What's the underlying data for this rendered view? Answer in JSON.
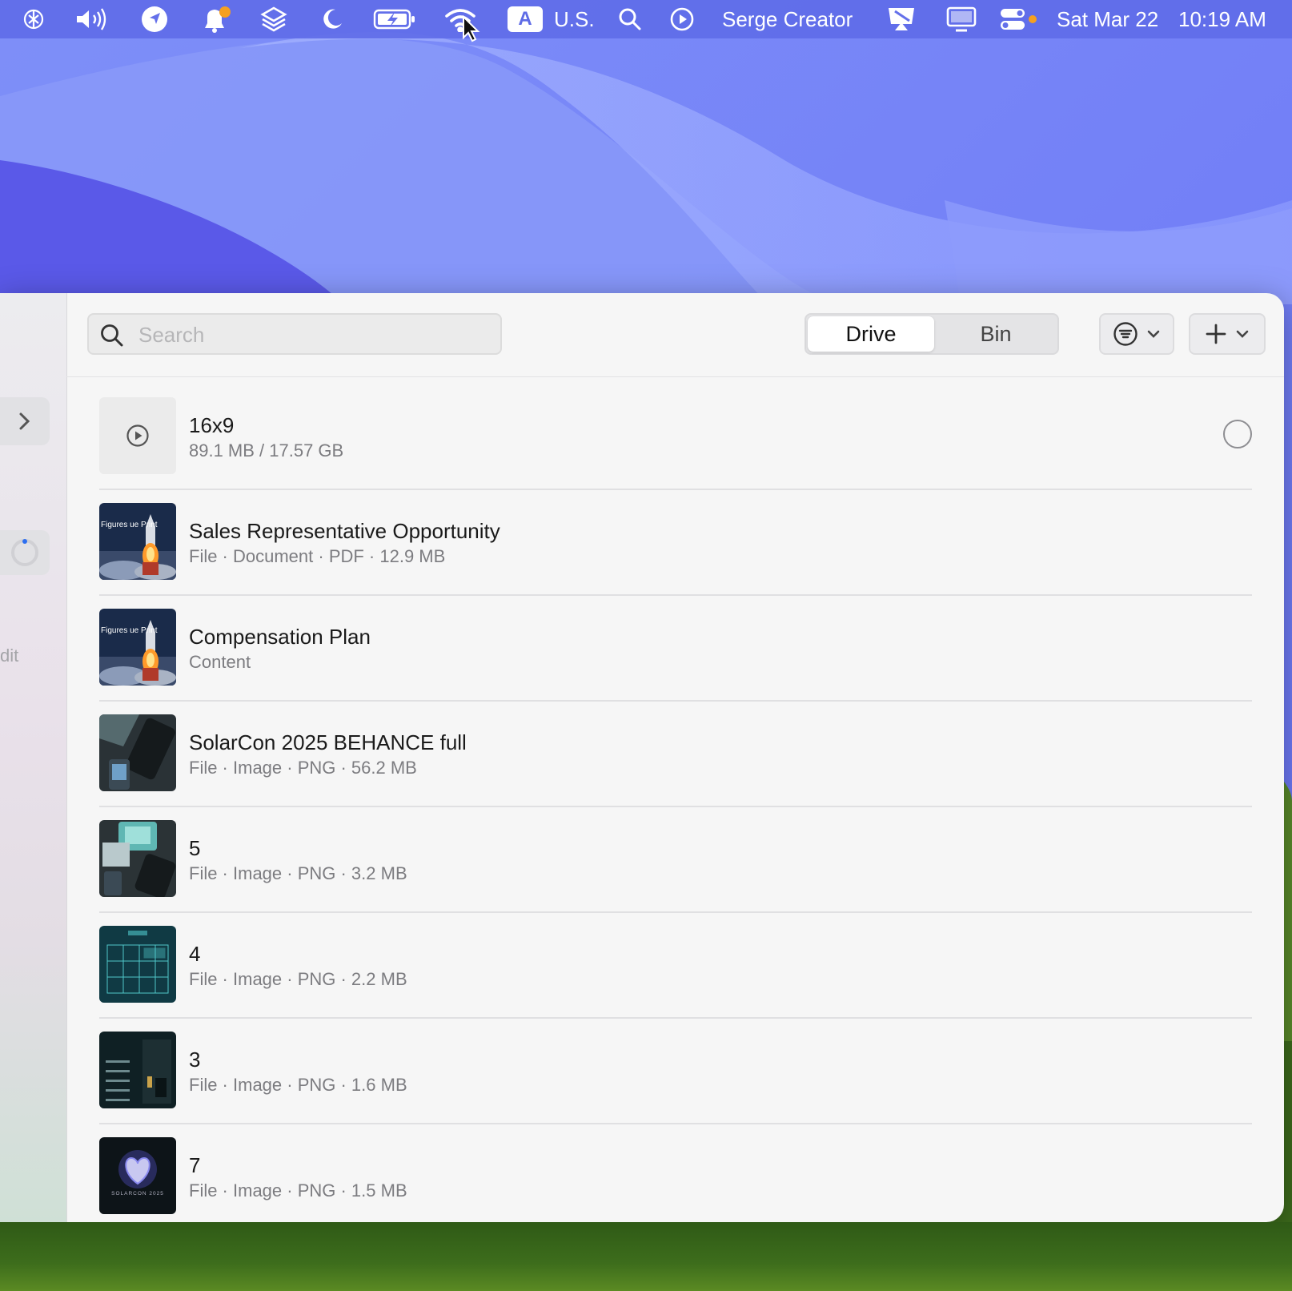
{
  "menubar": {
    "icons": [
      "openai-icon",
      "volume-icon",
      "location-icon",
      "notifications-icon",
      "layers-icon",
      "moon-icon",
      "battery-charging-icon",
      "wifi-icon",
      "search-icon",
      "play-circle-icon",
      "airplay-icon",
      "display-icon",
      "control-center-icon"
    ],
    "input_source_letter": "A",
    "input_source": "U.S.",
    "user_name": "Serge Creator",
    "date": "Sat Mar 22",
    "time": "10:19 AM",
    "notification_dot_color": "#f5a020",
    "control_center_dot_color": "#f5a020"
  },
  "sidebar": {
    "edit_label": "dit"
  },
  "toolbar": {
    "search_placeholder": "Search",
    "tabs": [
      {
        "label": "Drive",
        "selected": true
      },
      {
        "label": "Bin",
        "selected": false
      }
    ],
    "filter_icon": "filter-list-icon",
    "add_icon": "plus-icon"
  },
  "files": [
    {
      "title": "16x9",
      "subtitle": "89.1 MB / 17.57 GB",
      "thumb": "play"
    },
    {
      "title": "Sales Representative Opportunity",
      "subtitle": "File · Document · PDF · 12.9 MB",
      "thumb": "rocket",
      "thumb_text": "Figures ue Print"
    },
    {
      "title": "Compensation Plan",
      "subtitle": "Content",
      "thumb": "rocket",
      "thumb_text": "Figures ue Print"
    },
    {
      "title": "SolarCon 2025 BEHANCE full",
      "subtitle": "File · Image · PNG · 56.2 MB",
      "thumb": "dark-devices"
    },
    {
      "title": "5",
      "subtitle": "File · Image · PNG · 3.2 MB",
      "thumb": "teal-devices"
    },
    {
      "title": "4",
      "subtitle": "File · Image · PNG · 2.2 MB",
      "thumb": "blueprint"
    },
    {
      "title": "3",
      "subtitle": "File · Image · PNG · 1.6 MB",
      "thumb": "dark-doc"
    },
    {
      "title": "7",
      "subtitle": "File · Image · PNG · 1.5 MB",
      "thumb": "heart",
      "thumb_text": "SOLARCON 2025"
    }
  ]
}
